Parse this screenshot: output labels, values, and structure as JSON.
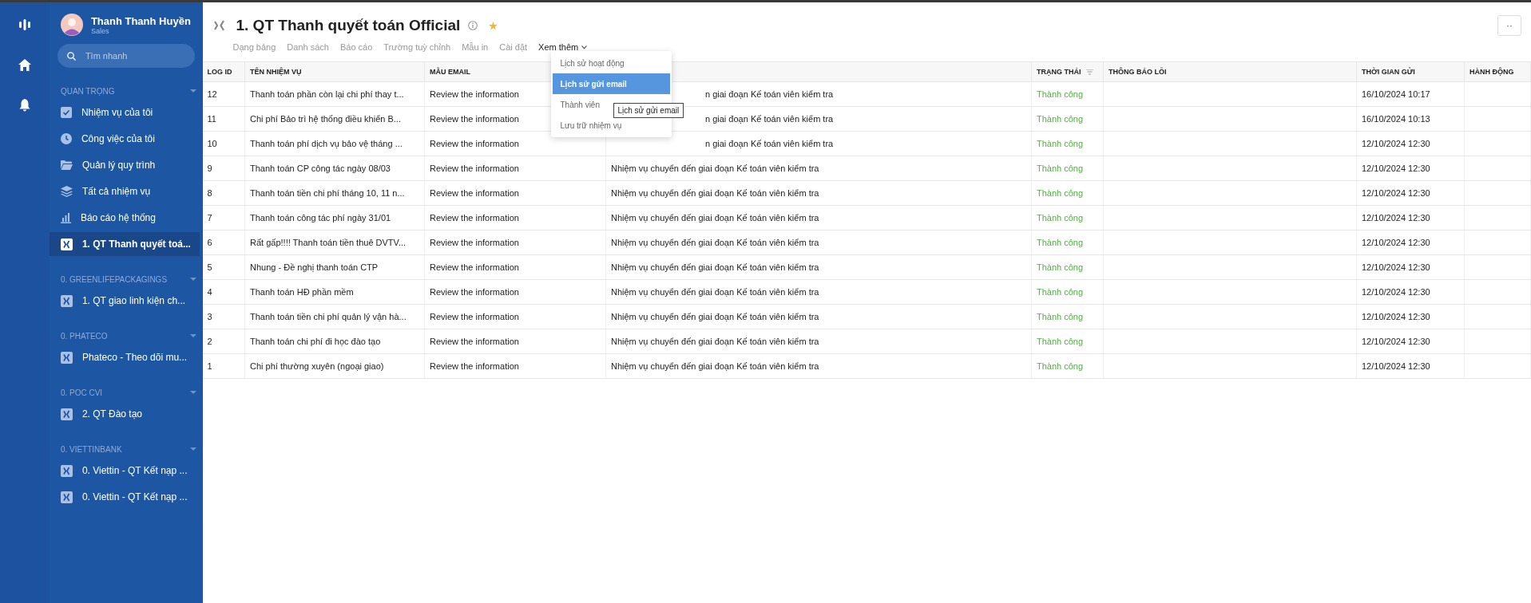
{
  "rail": {
    "icons": [
      {
        "kind": "logo"
      },
      {
        "kind": "home"
      },
      {
        "kind": "bell"
      }
    ]
  },
  "user": {
    "name": "Thanh Thanh Huyền",
    "role": "Sales"
  },
  "search": {
    "placeholder": "Tìm nhanh"
  },
  "sidebar": {
    "sections": [
      {
        "title": "QUAN TRỌNG",
        "items": [
          {
            "label": "Nhiệm vụ của tôi",
            "kind": "check",
            "selected": false
          },
          {
            "label": "Công việc của tôi",
            "kind": "clock",
            "selected": false
          },
          {
            "label": "Quản lý quy trình",
            "kind": "folder",
            "selected": false
          },
          {
            "label": "Tất cả nhiệm vụ",
            "kind": "layers",
            "selected": false
          },
          {
            "label": "Báo cáo hệ thống",
            "kind": "chart",
            "selected": false
          },
          {
            "label": "1. QT Thanh quyết toá...",
            "kind": "app",
            "selected": true
          }
        ]
      },
      {
        "title": "0. GREENLIFEPACKAGINGS",
        "items": [
          {
            "label": "1. QT giao linh kiện ch...",
            "kind": "app",
            "selected": false
          }
        ]
      },
      {
        "title": "0. PHATECO",
        "items": [
          {
            "label": "Phateco - Theo dõi mu...",
            "kind": "app",
            "selected": false
          }
        ]
      },
      {
        "title": "0. POC CVI",
        "items": [
          {
            "label": "2. QT Đào tạo",
            "kind": "app",
            "selected": false
          }
        ]
      },
      {
        "title": "0. VIETTINBANK",
        "items": [
          {
            "label": "0. Viettin - QT Kết nạp ...",
            "kind": "app",
            "selected": false
          },
          {
            "label": "0. Viettin - QT Kết nạp ...",
            "kind": "app",
            "selected": false
          }
        ]
      }
    ]
  },
  "header": {
    "title": "1. QT Thanh quyết toán Official",
    "starred": true,
    "more_button": "··",
    "tabs": [
      {
        "label": "Dạng bảng",
        "selected": false
      },
      {
        "label": "Danh sách",
        "selected": false
      },
      {
        "label": "Báo cáo",
        "selected": false
      },
      {
        "label": "Trường tuỳ chỉnh",
        "selected": false
      },
      {
        "label": "Mẫu in",
        "selected": false
      },
      {
        "label": "Cài đặt",
        "selected": false
      },
      {
        "label": "Xem thêm",
        "selected": true,
        "dropdown": true
      }
    ]
  },
  "dropdown": {
    "items": [
      {
        "label": "Lịch sử hoạt động",
        "selected": false
      },
      {
        "label": "Lịch sử gửi email",
        "selected": true
      },
      {
        "label": "Thành viên",
        "selected": false
      },
      {
        "label": "Lưu trữ nhiệm vụ",
        "selected": false
      }
    ],
    "tooltip": "Lịch sử gửi email"
  },
  "table": {
    "columns": [
      {
        "label": "LOG ID"
      },
      {
        "label": "TÊN NHIỆM VỤ"
      },
      {
        "label": "MẪU EMAIL"
      },
      {},
      {
        "label": "TRẠNG THÁI",
        "filter": true
      },
      {
        "label": "THÔNG BÁO LỖI"
      },
      {
        "label": "THỜI GIAN GỬI"
      },
      {
        "label": "HÀNH ĐỘNG"
      }
    ],
    "rows": [
      {
        "id": "12",
        "task": "Thanh toán phần còn lại chi phí thay t...",
        "template": "Review the information",
        "column_4": "n giai đoạn Kế toán viên kiểm tra",
        "covered": true,
        "status": "Thành công",
        "time": "16/10/2024 10:17"
      },
      {
        "id": "11",
        "task": "Chi phí Bảo trì hệ thống điều khiển B...",
        "template": "Review the information",
        "column_4": "n giai đoạn Kế toán viên kiểm tra",
        "covered": true,
        "status": "Thành công",
        "time": "16/10/2024 10:13"
      },
      {
        "id": "10",
        "task": "Thanh toán phí dịch vụ bảo vệ tháng ...",
        "template": "Review the information",
        "column_4": "n giai đoạn Kế toán viên kiểm tra",
        "covered": true,
        "status": "Thành công",
        "time": "12/10/2024 12:30"
      },
      {
        "id": "9",
        "task": "Thanh toán CP công tác ngày 08/03",
        "template": "Review the information",
        "column_4": "Nhiệm vụ chuyển đến giai đoạn Kế toán viên kiểm tra",
        "covered": false,
        "status": "Thành công",
        "time": "12/10/2024 12:30"
      },
      {
        "id": "8",
        "task": "Thanh toán tiền chi phí tháng 10, 11 n...",
        "template": "Review the information",
        "column_4": "Nhiệm vụ chuyển đến giai đoạn Kế toán viên kiểm tra",
        "covered": false,
        "status": "Thành công",
        "time": "12/10/2024 12:30"
      },
      {
        "id": "7",
        "task": "Thanh toán công tác phí ngày 31/01",
        "template": "Review the information",
        "column_4": "Nhiệm vụ chuyển đến giai đoạn Kế toán viên kiểm tra",
        "covered": false,
        "status": "Thành công",
        "time": "12/10/2024 12:30"
      },
      {
        "id": "6",
        "task": "Rất gấp!!!! Thanh toán tiền thuê DVTV...",
        "template": "Review the information",
        "column_4": "Nhiệm vụ chuyển đến giai đoạn Kế toán viên kiểm tra",
        "covered": false,
        "status": "Thành công",
        "time": "12/10/2024 12:30"
      },
      {
        "id": "5",
        "task": "Nhung - Đề nghị thanh toán CTP",
        "template": "Review the information",
        "column_4": "Nhiệm vụ chuyển đến giai đoạn Kế toán viên kiểm tra",
        "covered": false,
        "status": "Thành công",
        "time": "12/10/2024 12:30"
      },
      {
        "id": "4",
        "task": "Thanh toán HĐ phần mềm",
        "template": "Review the information",
        "column_4": "Nhiệm vụ chuyển đến giai đoạn Kế toán viên kiểm tra",
        "covered": false,
        "status": "Thành công",
        "time": "12/10/2024 12:30"
      },
      {
        "id": "3",
        "task": "Thanh toán tiền chi phí quản lý vận hà...",
        "template": "Review the information",
        "column_4": "Nhiệm vụ chuyển đến giai đoạn Kế toán viên kiểm tra",
        "covered": false,
        "status": "Thành công",
        "time": "12/10/2024 12:30"
      },
      {
        "id": "2",
        "task": "Thanh toán chi phí đi học đào tạo",
        "template": "Review the information",
        "column_4": "Nhiệm vụ chuyển đến giai đoạn Kế toán viên kiểm tra",
        "covered": false,
        "status": "Thành công",
        "time": "12/10/2024 12:30"
      },
      {
        "id": "1",
        "task": "Chi phí thường xuyên (ngoại giao)",
        "template": "Review the information",
        "column_4": "Nhiệm vụ chuyển đến giai đoạn Kế toán viên kiểm tra",
        "covered": false,
        "status": "Thành công",
        "time": "12/10/2024 12:30"
      }
    ]
  }
}
